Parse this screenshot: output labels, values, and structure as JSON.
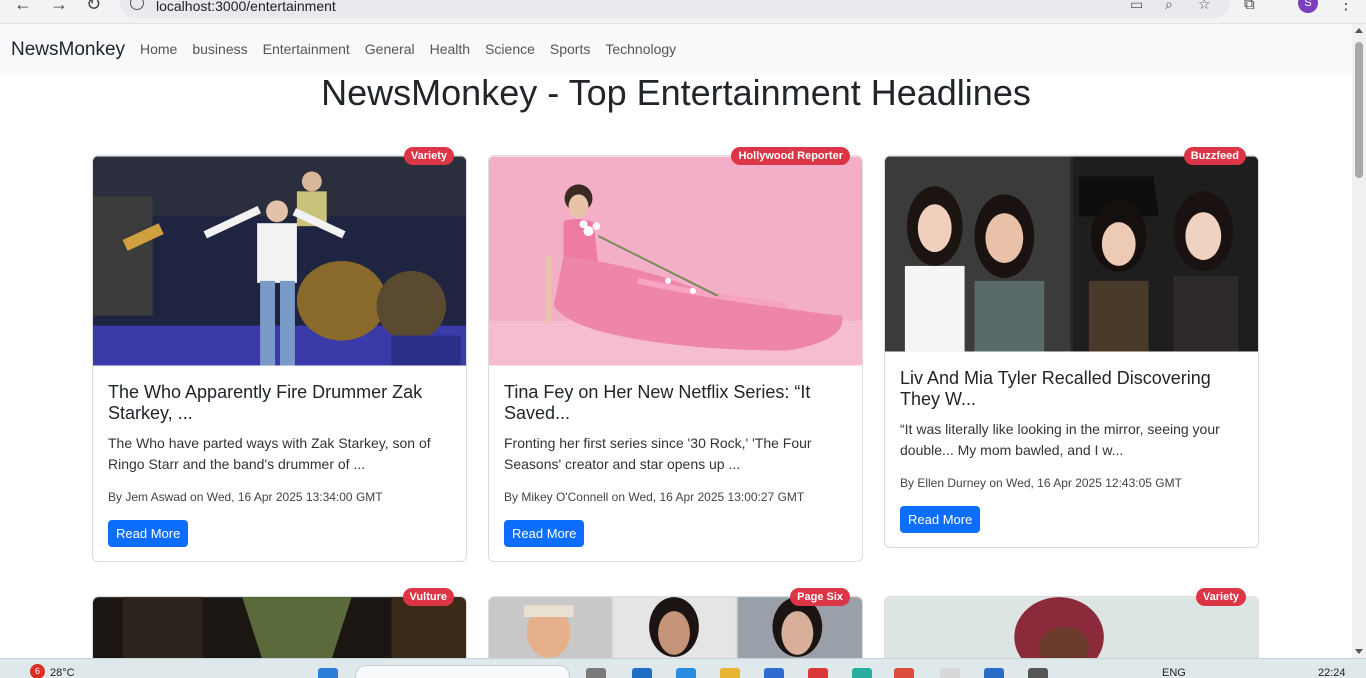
{
  "browser": {
    "url": "localhost:3000/entertainment",
    "profile_initial": "S"
  },
  "navbar": {
    "brand": "NewsMonkey",
    "links": [
      "Home",
      "business",
      "Entertainment",
      "General",
      "Health",
      "Science",
      "Sports",
      "Technology"
    ]
  },
  "page": {
    "title": "NewsMonkey - Top Entertainment Headlines"
  },
  "cards": [
    {
      "source": "Variety",
      "title": "The Who Apparently Fire Drummer Zak Starkey, ...",
      "description": "The Who have parted ways with Zak Starkey, son of Ringo Starr and the band's drummer of ...",
      "meta": "By Jem Aswad on Wed, 16 Apr 2025 13:34:00 GMT",
      "button": "Read More"
    },
    {
      "source": "Hollywood Reporter",
      "title": "Tina Fey on Her New Netflix Series: “It Saved...",
      "description": "Fronting her first series since '30 Rock,' 'The Four Seasons' creator and star opens up ...",
      "meta": "By Mikey O'Connell on Wed, 16 Apr 2025 13:00:27 GMT",
      "button": "Read More"
    },
    {
      "source": "Buzzfeed",
      "title": "Liv And Mia Tyler Recalled Discovering They W...",
      "description": "“It was literally like looking in the mirror, seeing your double... My mom bawled, and I w...",
      "meta": "By Ellen Durney on Wed, 16 Apr 2025 12:43:05 GMT",
      "button": "Read More"
    },
    {
      "source": "Vulture"
    },
    {
      "source": "Page Six"
    },
    {
      "source": "Variety"
    }
  ],
  "taskbar": {
    "notification_count": "6",
    "temperature": "28°C",
    "language": "ENG",
    "time": "22:24"
  },
  "colors": {
    "badge": "#dc3545",
    "button": "#0d6efd",
    "navbar_bg": "#f8f9fa"
  }
}
